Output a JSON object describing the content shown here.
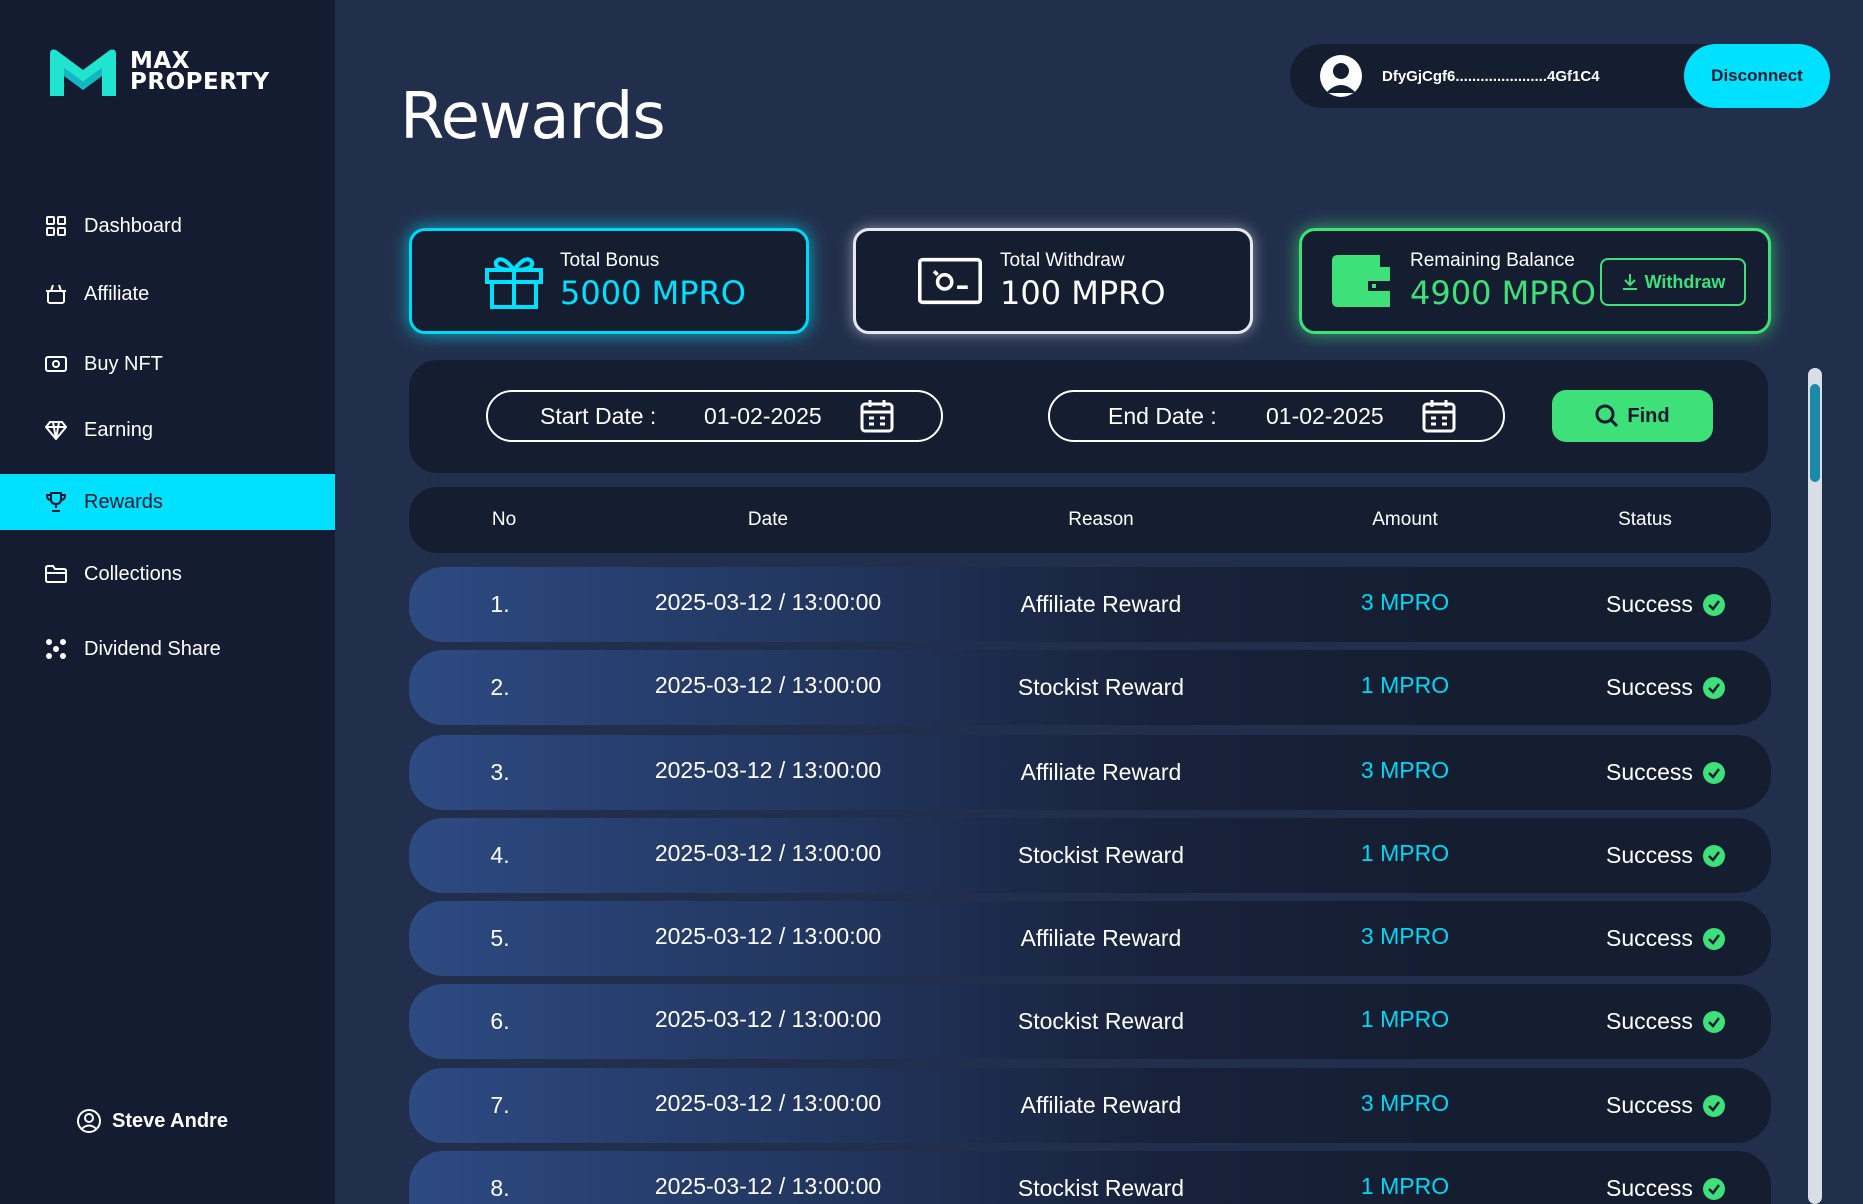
{
  "brand": {
    "logo_line1": "MAX",
    "logo_line2": "PROPERTY"
  },
  "sidebar": {
    "items": [
      {
        "label": "Dashboard",
        "icon": "grid-icon"
      },
      {
        "label": "Affiliate",
        "icon": "basket-icon"
      },
      {
        "label": "Buy NFT",
        "icon": "cash-icon"
      },
      {
        "label": "Earning",
        "icon": "diamond-icon"
      },
      {
        "label": "Rewards",
        "icon": "trophy-icon",
        "active": true
      },
      {
        "label": "Collections",
        "icon": "folder-icon"
      },
      {
        "label": "Dividend Share",
        "icon": "nodes-icon"
      }
    ],
    "user_name": "Steve Andre"
  },
  "page": {
    "title": "Rewards"
  },
  "wallet": {
    "address": "DfyGjCgf6......................4Gf1C4",
    "disconnect_label": "Disconnect"
  },
  "cards": {
    "bonus": {
      "label": "Total Bonus",
      "value": "5000 MPRO"
    },
    "withdraw": {
      "label": "Total Withdraw",
      "value": "100 MPRO"
    },
    "balance": {
      "label": "Remaining Balance",
      "value": "4900 MPRO",
      "button_label": "Withdraw"
    }
  },
  "filter": {
    "start_label": "Start Date :",
    "start_value": "01-02-2025",
    "end_label": "End Date :",
    "end_value": "01-02-2025",
    "find_label": "Find"
  },
  "table": {
    "headers": [
      "No",
      "Date",
      "Reason",
      "Amount",
      "Status"
    ],
    "rows": [
      {
        "no": "1.",
        "date": "2025-03-12 / 13:00:00",
        "reason": "Affiliate Reward",
        "amount": "3 MPRO",
        "status": "Success"
      },
      {
        "no": "2.",
        "date": "2025-03-12 / 13:00:00",
        "reason": "Stockist Reward",
        "amount": "1 MPRO",
        "status": "Success"
      },
      {
        "no": "3.",
        "date": "2025-03-12 / 13:00:00",
        "reason": "Affiliate Reward",
        "amount": "3 MPRO",
        "status": "Success"
      },
      {
        "no": "4.",
        "date": "2025-03-12 / 13:00:00",
        "reason": "Stockist Reward",
        "amount": "1 MPRO",
        "status": "Success"
      },
      {
        "no": "5.",
        "date": "2025-03-12 / 13:00:00",
        "reason": "Affiliate Reward",
        "amount": "3 MPRO",
        "status": "Success"
      },
      {
        "no": "6.",
        "date": "2025-03-12 / 13:00:00",
        "reason": "Stockist Reward",
        "amount": "1 MPRO",
        "status": "Success"
      },
      {
        "no": "7.",
        "date": "2025-03-12 / 13:00:00",
        "reason": "Affiliate Reward",
        "amount": "3 MPRO",
        "status": "Success"
      },
      {
        "no": "8.",
        "date": "2025-03-12 / 13:00:00",
        "reason": "Stockist Reward",
        "amount": "1 MPRO",
        "status": "Success"
      }
    ]
  },
  "colors": {
    "accent_cyan": "#00e1ff",
    "accent_green": "#3ee07a",
    "background": "#222f4c",
    "panel": "#151d31",
    "sidebar": "#141c31"
  }
}
